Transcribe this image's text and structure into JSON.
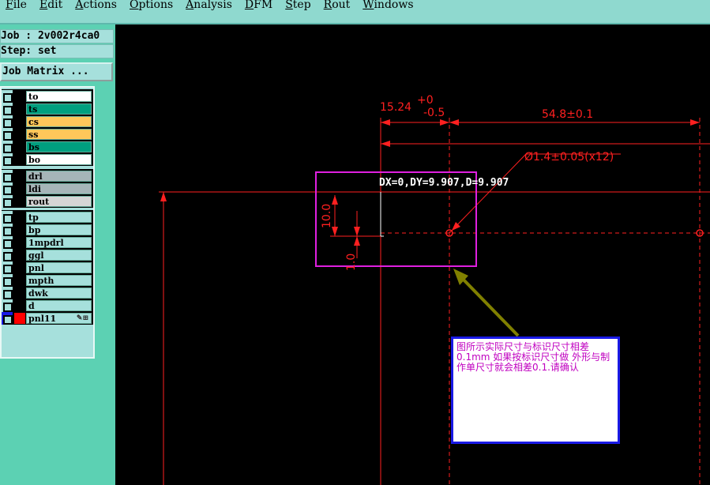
{
  "menubar": {
    "items": [
      "File",
      "Edit",
      "Actions",
      "Options",
      "Analysis",
      "DFM",
      "Step",
      "Rout",
      "Windows"
    ]
  },
  "job": {
    "job_line": "Job : 2v002r4ca0",
    "step_line": "Step: set",
    "matrix_button": "Job Matrix ..."
  },
  "layers": [
    {
      "name": "to",
      "color": "#ffffff",
      "group": 0
    },
    {
      "name": "ts",
      "color": "#009f7f",
      "group": 0
    },
    {
      "name": "cs",
      "color": "#ffc75a",
      "group": 0
    },
    {
      "name": "ss",
      "color": "#ffc75a",
      "group": 0
    },
    {
      "name": "bs",
      "color": "#009f7f",
      "group": 0
    },
    {
      "name": "bo",
      "color": "#ffffff",
      "group": 0
    },
    {
      "name": "drl",
      "color": "#a6b5b8",
      "group": 1
    },
    {
      "name": "ldi",
      "color": "#a6b5b8",
      "group": 1
    },
    {
      "name": "rout",
      "color": "#d6d6d6",
      "group": 1
    },
    {
      "name": "tp",
      "color": "#a6e0dc",
      "group": 2
    },
    {
      "name": "bp",
      "color": "#a6e0dc",
      "group": 2
    },
    {
      "name": "1mpdrl",
      "color": "#a6e0dc",
      "group": 2
    },
    {
      "name": "ggl",
      "color": "#a6e0dc",
      "group": 2
    },
    {
      "name": "pnl",
      "color": "#a6e0dc",
      "group": 2
    },
    {
      "name": "mpth",
      "color": "#a6e0dc",
      "group": 2
    },
    {
      "name": "dwk",
      "color": "#a6e0dc",
      "group": 2
    },
    {
      "name": "d",
      "color": "#a6e0dc",
      "group": 2
    },
    {
      "name": "pnl11",
      "color": "#a6e0dc",
      "group": 2,
      "active": true,
      "swatch": "#ff0000"
    }
  ],
  "canvas": {
    "readout": "DX=0,DY=9.907,D=9.907",
    "dims": {
      "top_left": "15.24",
      "tol_plus": "+0",
      "tol_minus": "-0.5",
      "top_right": "54.8±0.1",
      "hole": "Ø1.4±0.05(x12)",
      "vertical": "10.0",
      "vertical_small": "1.0"
    },
    "note": "图所示实际尺寸与标识尺寸相差0.1mm  如果按标识尺寸做 外形与制作单尺寸就会相差0.1.请确认"
  },
  "colors": {
    "dim": "#ff2020",
    "highlight": "#e020e0",
    "arrow": "#808000",
    "note_border": "#1a1ae6"
  }
}
